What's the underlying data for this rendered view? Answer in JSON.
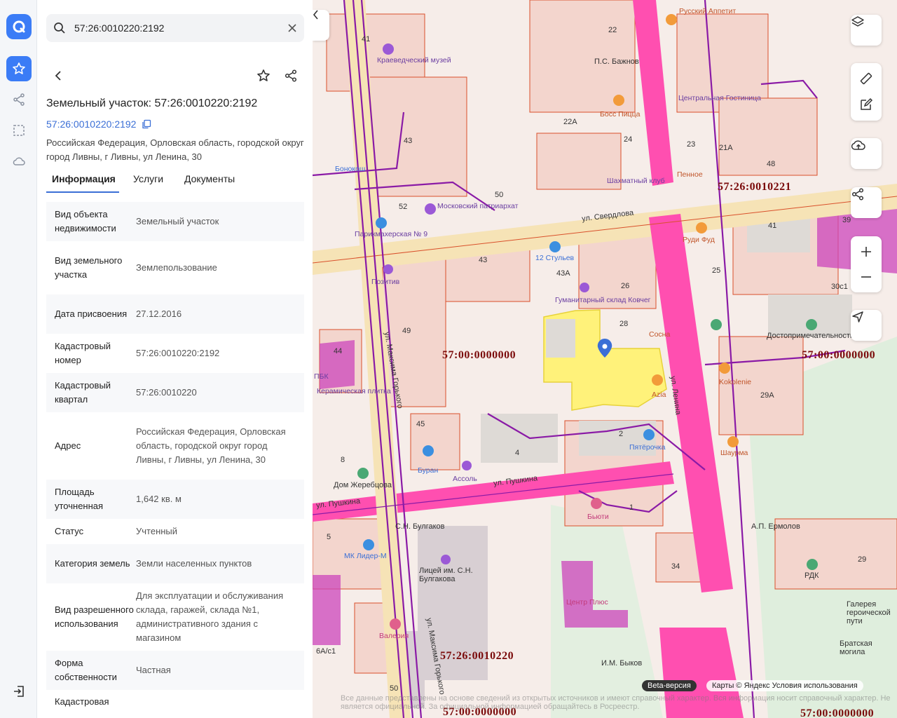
{
  "search": {
    "value": "57:26:0010220:2192"
  },
  "card": {
    "title": "Земельный участок: 57:26:0010220:2192",
    "cad_link": "57:26:0010220:2192",
    "address": "Российская Федерация, Орловская область, городской округ город Ливны, г Ливны, ул Ленина, 30"
  },
  "tabs": [
    {
      "label": "Информация"
    },
    {
      "label": "Услуги"
    },
    {
      "label": "Документы"
    }
  ],
  "info_rows": [
    {
      "key": "Вид объекта недвижимости",
      "value": "Земельный участок"
    },
    {
      "key": "Вид земельного участка",
      "value": "Землепользование"
    },
    {
      "key": "Дата присвоения",
      "value": "27.12.2016"
    },
    {
      "key": "Кадастровый номер",
      "value": "57:26:0010220:2192"
    },
    {
      "key": "Кадастровый квартал",
      "value": "57:26:0010220"
    },
    {
      "key": "Адрес",
      "value": "Российская Федерация, Орловская область, городской округ город Ливны, г Ливны, ул Ленина, 30"
    },
    {
      "key": "Площадь уточненная",
      "value": "1,642 кв. м"
    },
    {
      "key": "Статус",
      "value": "Учтенный"
    },
    {
      "key": "Категория земель",
      "value": "Земли населенных пунктов"
    },
    {
      "key": "Вид разрешенного использования",
      "value": "Для эксплуатации и обслуживания склада, гаражей, склада №1, административного здания с магазином"
    },
    {
      "key": "Форма собственности",
      "value": "Частная"
    },
    {
      "key": "Кадастровая",
      "value": ""
    }
  ],
  "map": {
    "cad_labels": [
      "57:00:0000000",
      "57:26:0010221",
      "57:00:0000000",
      "57:26:0010220",
      "57:00:0000000",
      "57:00:0000000"
    ],
    "streets": [
      "ул. Свердлова",
      "ул. Максима Горького",
      "ул. Ленина",
      "ул. Пушкина",
      "ул. Максима Горького",
      "ул. Пушкина"
    ],
    "pois": [
      "Краеведческий музей",
      "Русский Аппетит",
      "П.С. Бажнов",
      "Центральная Гостиница",
      "Босс Пицца",
      "Бонокош",
      "Шахматный клуб",
      "Пенное",
      "Московский патриархат",
      "Руди Фуд",
      "12 Стульев",
      "Гуманитарный склад Ковчег",
      "Позитив",
      "Сосна",
      "Достопримечательности",
      "Керамическая плитка",
      "Kokolenie",
      "Azia",
      "Пятёрочка",
      "Шаурма",
      "Буран",
      "Ассоль",
      "Дом Жеребцова",
      "Бьюти",
      "МК Лидер-М",
      "А.П. Ермолов",
      "Лицей им. С.Н. Булгакова",
      "Центр Плюс",
      "РДК",
      "Галерея героической пути",
      "Братская могила",
      "И.М. Быков",
      "Валерия",
      "С.Н. Булгаков",
      "Парикмахерская № 9",
      "ПБК"
    ],
    "numbers": [
      "41",
      "22",
      "43",
      "22А",
      "24",
      "23",
      "21А",
      "48",
      "50",
      "52",
      "41",
      "39",
      "43",
      "43А",
      "26",
      "25",
      "30с1",
      "28",
      "49",
      "44",
      "45",
      "4",
      "2",
      "29А",
      "8",
      "1",
      "5",
      "34",
      "29",
      "6А/с1",
      "50"
    ],
    "beta": "Beta-версия",
    "attribution": "Карты © Яндекс   Условия использования",
    "disclaimer": "Все данные представлены на основе сведений из открытых источников и имеют справочный характер. Вся информация носит справочный характер. Не является официальной. За официальной информацией обращайтесь в Росреестр."
  },
  "colors": {
    "accent": "#3b6fd6",
    "parcel": "#fff27a",
    "road": "#ff4fb0",
    "boundary": "#d9502b",
    "purple": "#8a1aa6"
  }
}
